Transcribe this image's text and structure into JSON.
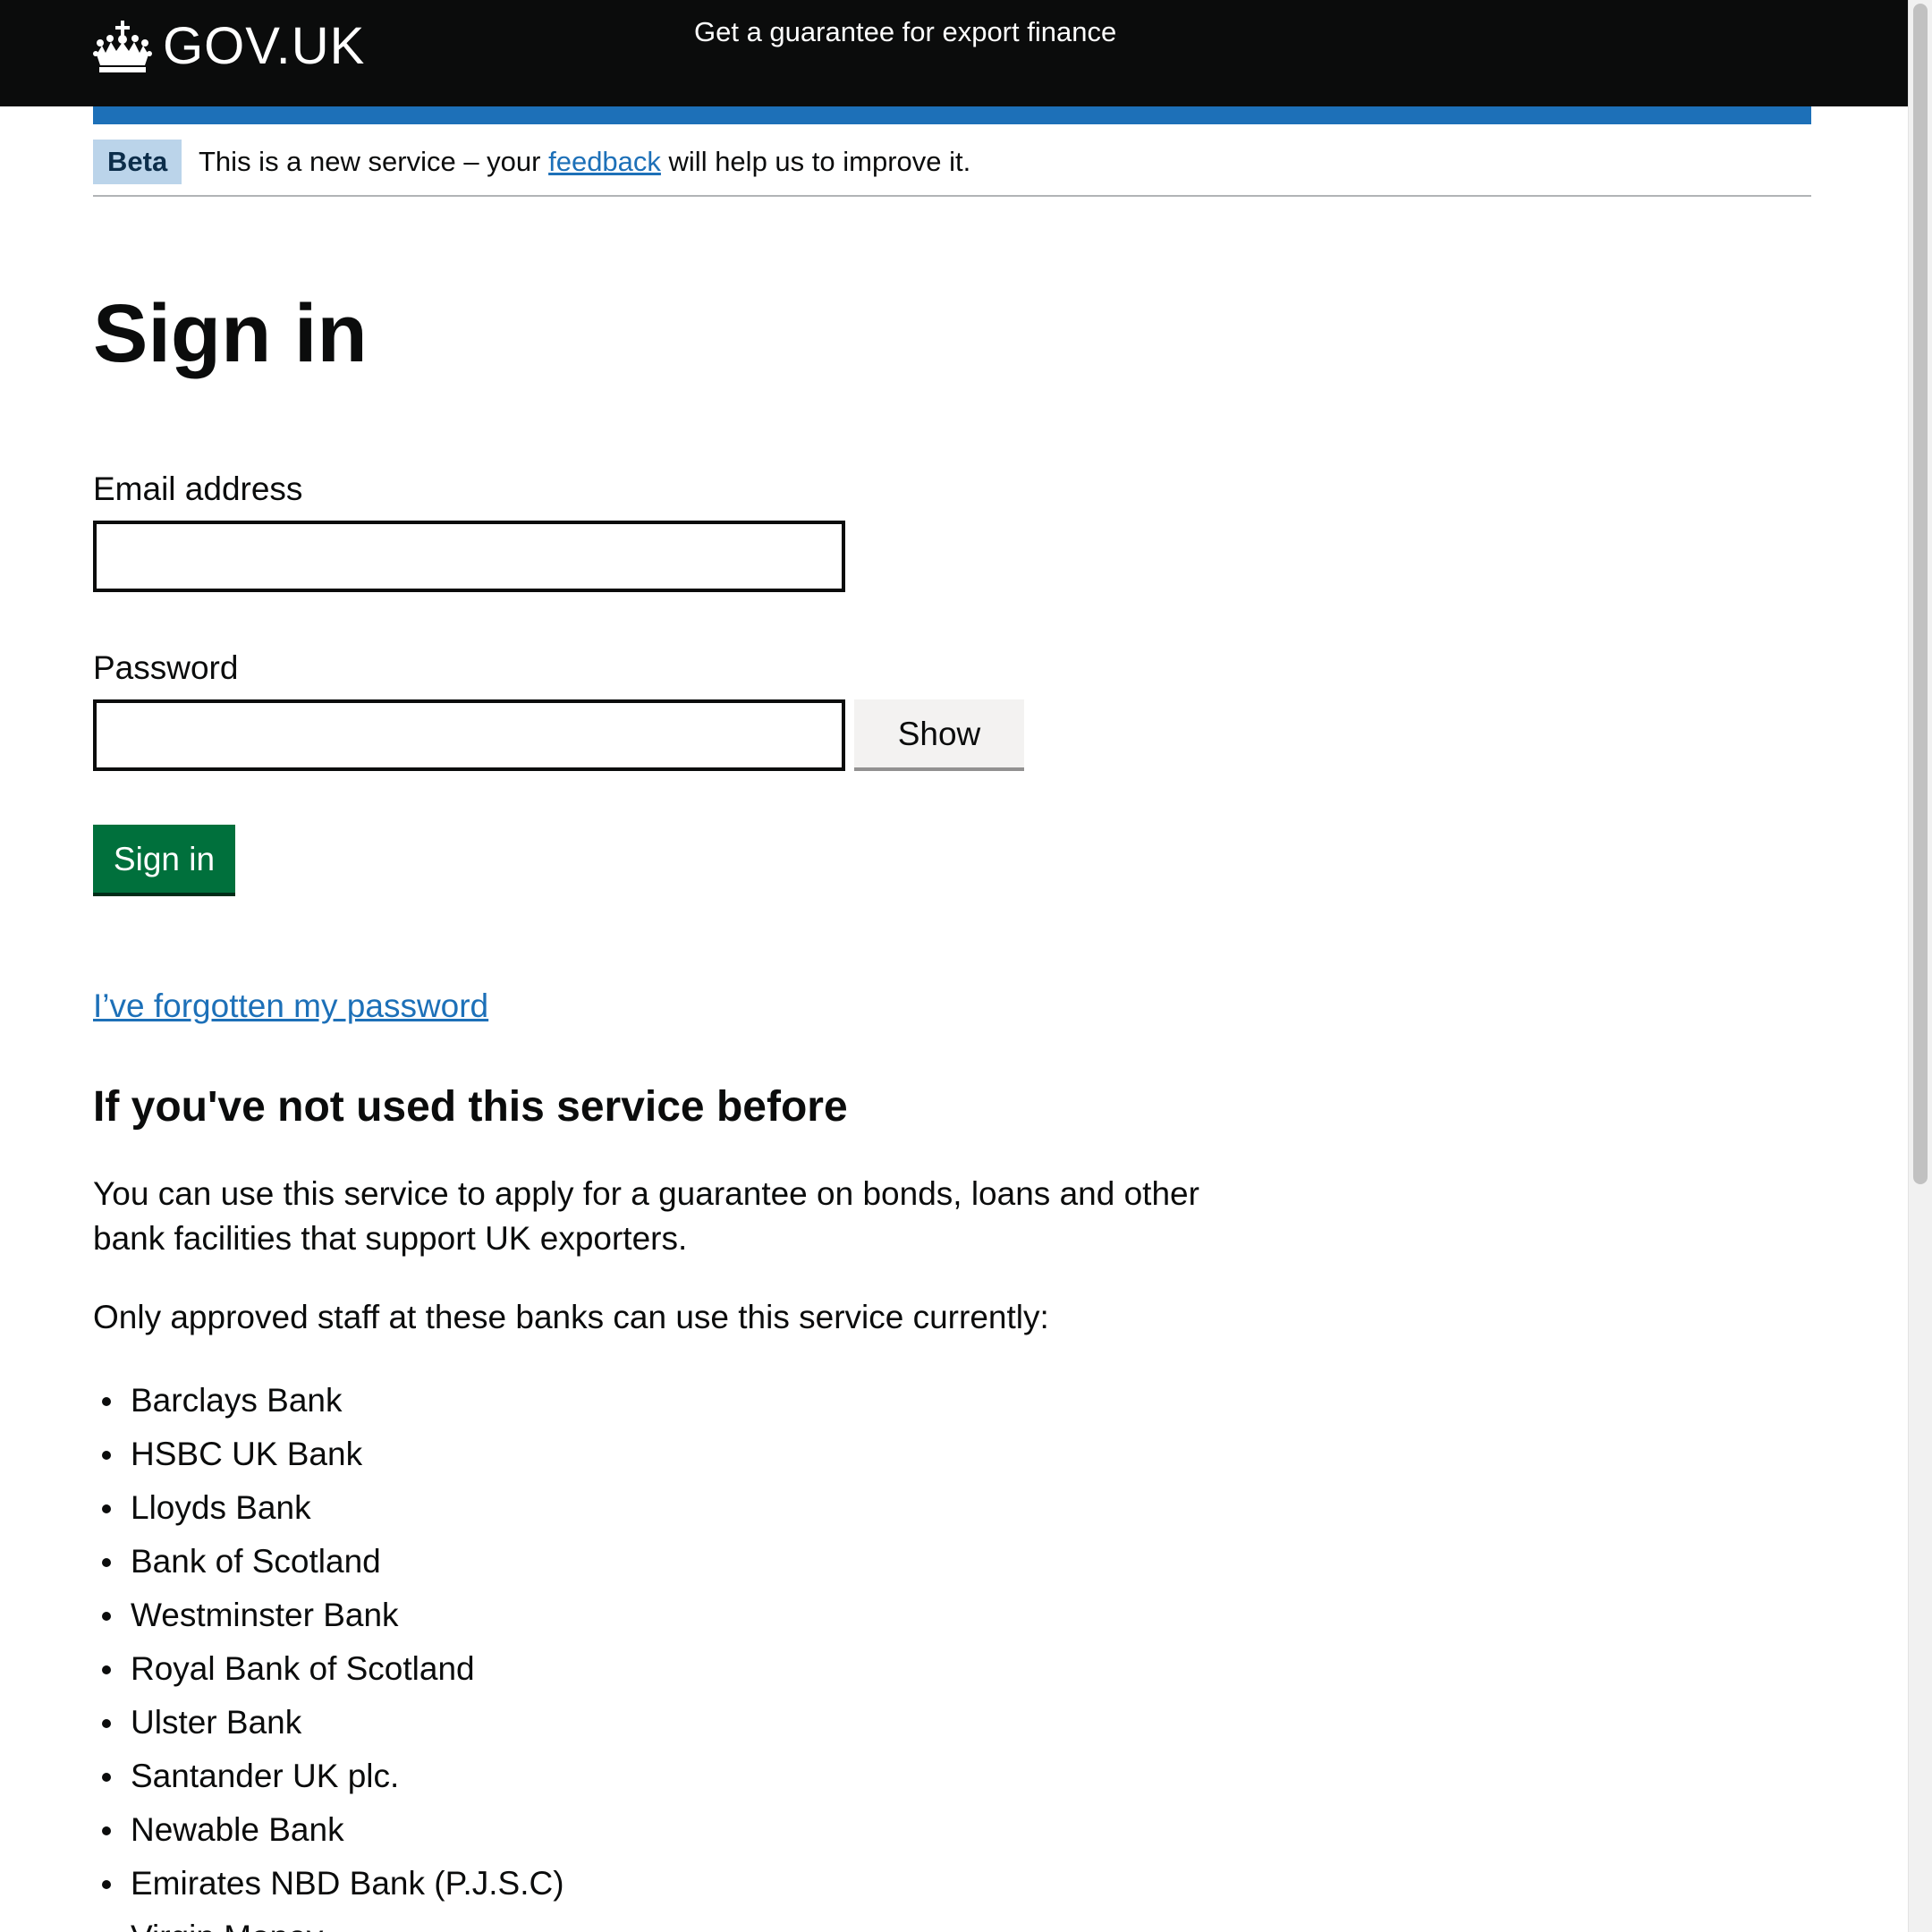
{
  "header": {
    "logo_text": "GOV.UK",
    "service_name": "Get a guarantee for export finance",
    "logo_icon": "crown-icon"
  },
  "phase_banner": {
    "tag": "Beta",
    "text_before": "This is a new service – your ",
    "link_text": "feedback",
    "text_after": " will help us to improve it."
  },
  "main": {
    "title": "Sign in",
    "email_label": "Email address",
    "email_value": "",
    "password_label": "Password",
    "password_value": "",
    "show_button": "Show",
    "sign_in_button": "Sign in",
    "forgot_link": "I’ve forgotten my password",
    "new_heading": "If you've not used this service before",
    "intro_paragraph": "You can use this service to apply for a guarantee on bonds, loans and other bank facilities that support UK exporters.",
    "banks_intro": "Only approved staff at these banks can use this service currently:",
    "banks": [
      "Barclays Bank",
      "HSBC UK Bank",
      "Lloyds Bank",
      "Bank of Scotland",
      "Westminster Bank",
      "Royal Bank of Scotland",
      "Ulster Bank",
      "Santander UK plc.",
      "Newable Bank",
      "Emirates NBD Bank (P.J.S.C)",
      "Virgin Money"
    ]
  },
  "colors": {
    "header_bg": "#0b0c0c",
    "accent_blue": "#1d70b8",
    "link": "#1d70b8",
    "button_green": "#00703c",
    "secondary_button": "#f3f2f1",
    "beta_tag_bg": "#bbd4ea"
  }
}
